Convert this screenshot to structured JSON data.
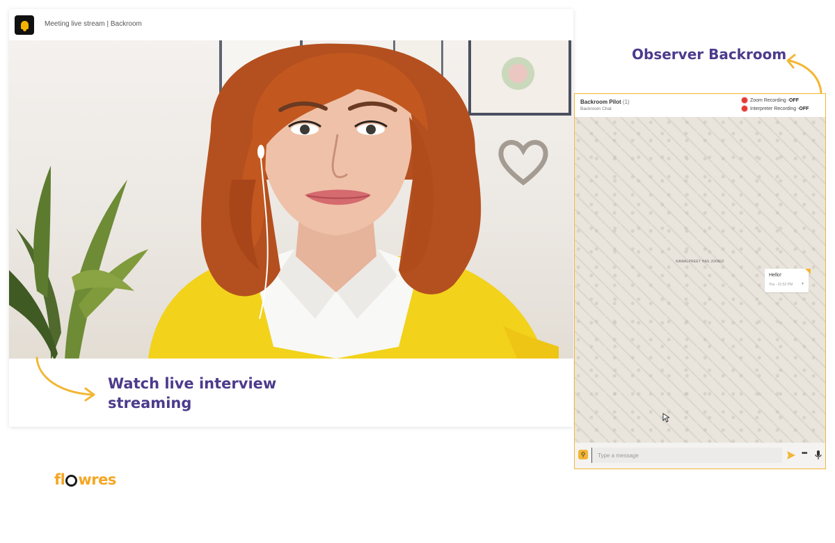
{
  "stream": {
    "title": "Meeting live stream | Backroom",
    "caption": "Watch live interview streaming"
  },
  "backroom": {
    "title": "Observer Backroom",
    "chat": {
      "name": "Backroom Pilot",
      "count": "(1)",
      "subtitle": "Backroom Chat",
      "recordings": [
        {
          "label": "Zoom Recording - ",
          "status": "OFF"
        },
        {
          "label": "Interpreter Recording - ",
          "status": "OFF"
        }
      ],
      "system_message": "KAWALPREET HAS JOINED",
      "messages": [
        {
          "text": "Hello!",
          "meta": "You - 01:52 PM"
        }
      ],
      "input_placeholder": "Type a message",
      "more_label": "•••"
    }
  },
  "brand": {
    "prefix": "fl",
    "suffix": "wres"
  },
  "colors": {
    "accent": "#f3b634",
    "heading": "#4d3b8c",
    "recording_dot": "#e53935"
  }
}
